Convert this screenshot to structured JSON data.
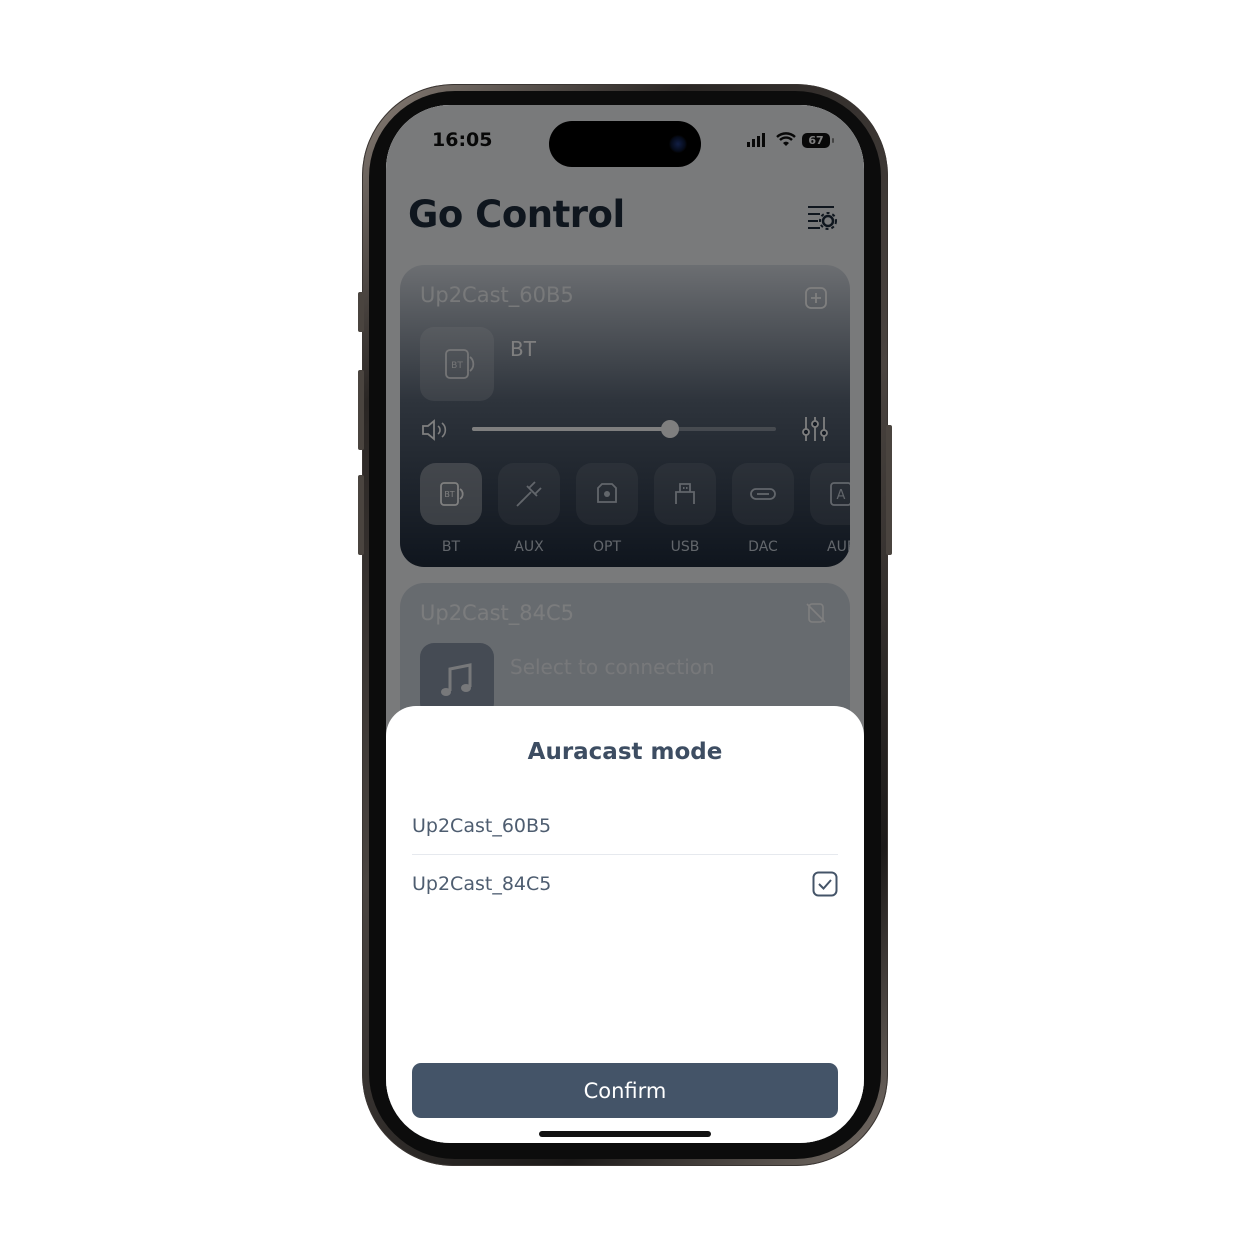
{
  "status_bar": {
    "time": "16:05",
    "battery": "67"
  },
  "app": {
    "title": "Go Control"
  },
  "devices": [
    {
      "name": "Up2Cast_60B5",
      "current_source": "BT",
      "volume_level": 0.65,
      "sources": [
        {
          "label": "BT",
          "icon": "bluetooth-source-icon",
          "active": true
        },
        {
          "label": "AUX",
          "icon": "aux-cable-icon",
          "active": false
        },
        {
          "label": "OPT",
          "icon": "optical-icon",
          "active": false
        },
        {
          "label": "USB",
          "icon": "usb-icon",
          "active": false
        },
        {
          "label": "DAC",
          "icon": "dac-icon",
          "active": false
        },
        {
          "label": "AUF",
          "icon": "auracast-icon",
          "active": false
        }
      ]
    },
    {
      "name": "Up2Cast_84C5",
      "hint": "Select to connection"
    }
  ],
  "sheet": {
    "title": "Auracast mode",
    "options": [
      {
        "label": "Up2Cast_60B5",
        "checked": false
      },
      {
        "label": "Up2Cast_84C5",
        "checked": true
      }
    ],
    "confirm_label": "Confirm"
  },
  "colors": {
    "accent": "#445468",
    "title_text": "#3d4d62"
  }
}
